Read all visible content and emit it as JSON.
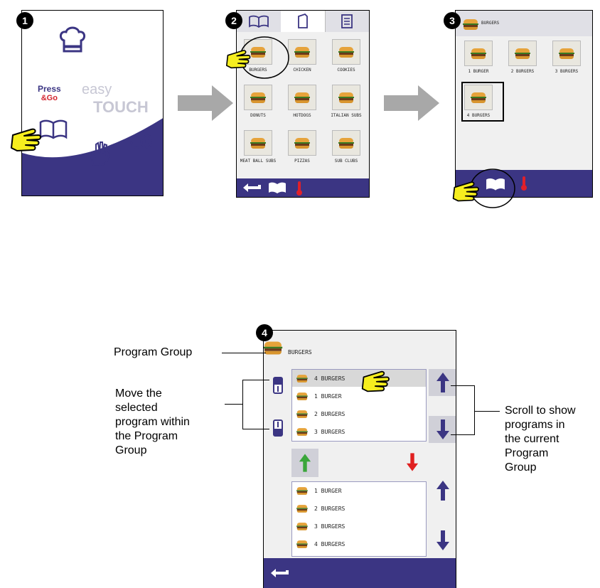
{
  "steps": [
    "1",
    "2",
    "3",
    "4"
  ],
  "panel1": {
    "logo_press": "Press",
    "logo_go": "&Go",
    "logo_easy": "easy",
    "logo_touch": "TOUCH",
    "icons": [
      "chef-hat-icon",
      "book-icon",
      "hand-icon",
      "sound-icon",
      "pointing-hand-icon"
    ]
  },
  "panel2": {
    "tabs": [
      "book-tab",
      "document-tab",
      "list-tab"
    ],
    "items": [
      "BURGERS",
      "CHICKEN",
      "COOKIES",
      "DONUTS",
      "HOTDOGS",
      "ITALIAN SUBS",
      "MEAT BALL SUBS",
      "PIZZAS",
      "SUB CLUBS"
    ]
  },
  "panel3": {
    "header": "BURGERS",
    "items": [
      "1 BURGER",
      "2 BURGERS",
      "3 BURGERS",
      "4 BURGERS"
    ]
  },
  "panel4": {
    "header": "BURGERS",
    "upper_list": [
      "4 BURGERS",
      "1 BURGER",
      "2 BURGERS",
      "3 BURGERS"
    ],
    "lower_list": [
      "1 BURGER",
      "2 BURGERS",
      "3 BURGERS",
      "4 BURGERS"
    ]
  },
  "callouts": {
    "program_group": "Program Group",
    "move": [
      "Move the",
      "selected",
      "program within",
      "the Program",
      "Group"
    ],
    "scroll": [
      "Scroll to show",
      "programs in",
      "the current",
      "Program",
      "Group"
    ]
  },
  "colors": {
    "bar": "#3b3583",
    "arrow": "#a8a8a8",
    "hand": "#f6ee1e",
    "up_green": "#3aa63a",
    "down_red": "#e02020"
  }
}
